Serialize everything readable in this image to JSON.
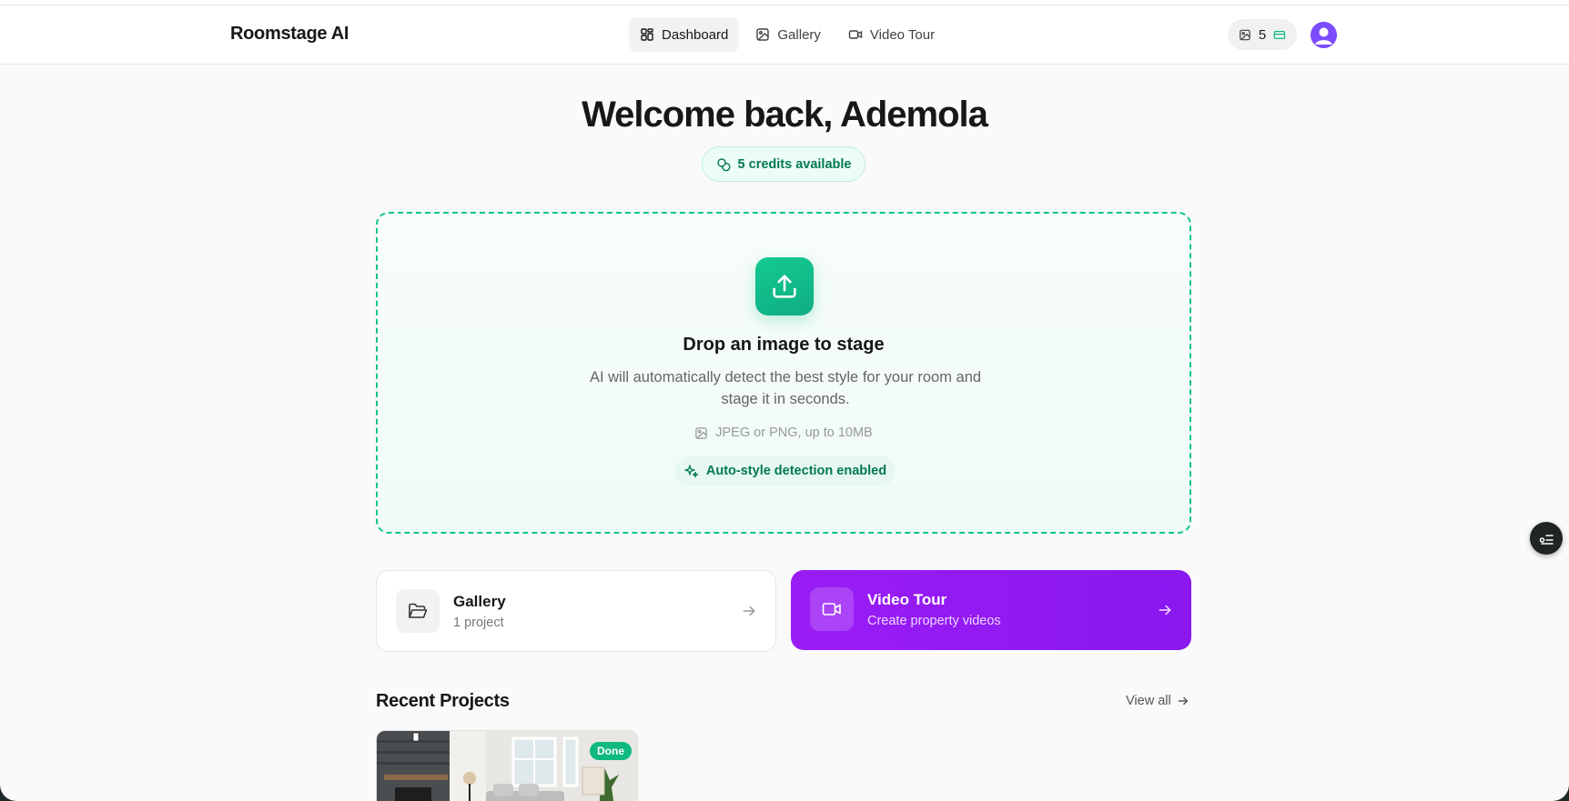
{
  "header": {
    "brand": "Roomstage AI",
    "nav": [
      {
        "label": "Dashboard",
        "icon": "dashboard-grid-icon",
        "active": true
      },
      {
        "label": "Gallery",
        "icon": "image-icon",
        "active": false
      },
      {
        "label": "Video Tour",
        "icon": "video-camera-icon",
        "active": false
      }
    ],
    "credits_count": "5"
  },
  "main": {
    "welcome": "Welcome back, Ademola",
    "credits_badge": "5 credits available",
    "dropzone": {
      "title": "Drop an image to stage",
      "description": "AI will automatically detect the best style for your room and stage it in seconds.",
      "formats": "JPEG or PNG, up to 10MB",
      "auto_style": "Auto-style detection enabled"
    },
    "cards": {
      "gallery": {
        "title": "Gallery",
        "subtitle": "1 project"
      },
      "video": {
        "title": "Video Tour",
        "subtitle": "Create property videos"
      }
    },
    "recent": {
      "title": "Recent Projects",
      "view_all": "View all",
      "projects": [
        {
          "status": "Done"
        }
      ]
    }
  },
  "colors": {
    "accent_green": "#10b981",
    "accent_purple": "#9a1cf5"
  }
}
